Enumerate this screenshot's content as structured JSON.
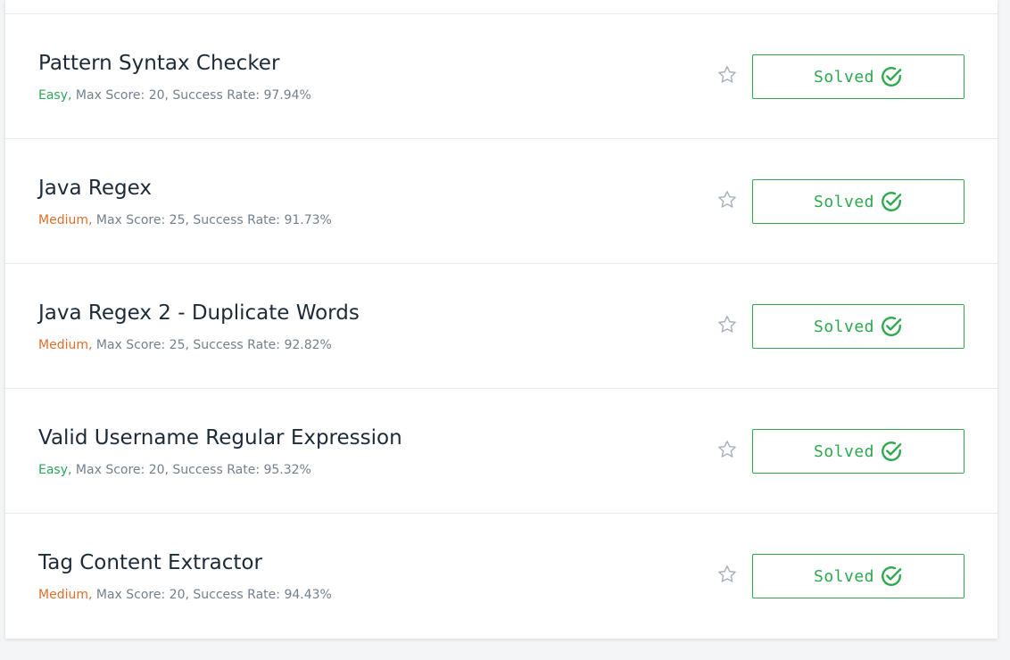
{
  "challenges": [
    {
      "title": "Pattern Syntax Checker",
      "difficulty": "Easy",
      "difficulty_level": "easy",
      "details": " Max Score: 20, Success Rate: 97.94%",
      "status_label": "Solved"
    },
    {
      "title": "Java Regex",
      "difficulty": "Medium",
      "difficulty_level": "medium",
      "details": " Max Score: 25, Success Rate: 91.73%",
      "status_label": "Solved"
    },
    {
      "title": "Java Regex 2 - Duplicate Words",
      "difficulty": "Medium",
      "difficulty_level": "medium",
      "details": " Max Score: 25, Success Rate: 92.82%",
      "status_label": "Solved"
    },
    {
      "title": "Valid Username Regular Expression",
      "difficulty": "Easy",
      "difficulty_level": "easy",
      "details": " Max Score: 20, Success Rate: 95.32%",
      "status_label": "Solved"
    },
    {
      "title": "Tag Content Extractor",
      "difficulty": "Medium",
      "difficulty_level": "medium",
      "details": " Max Score: 20, Success Rate: 94.43%",
      "status_label": "Solved"
    }
  ],
  "separator": ",",
  "icons": {
    "bookmark": "star-outline-icon",
    "solved": "check-circle-icon"
  },
  "colors": {
    "easy": "#2fa558",
    "medium": "#dc6e2c",
    "solved": "#2ea84f",
    "star": "#a9b3bd"
  }
}
